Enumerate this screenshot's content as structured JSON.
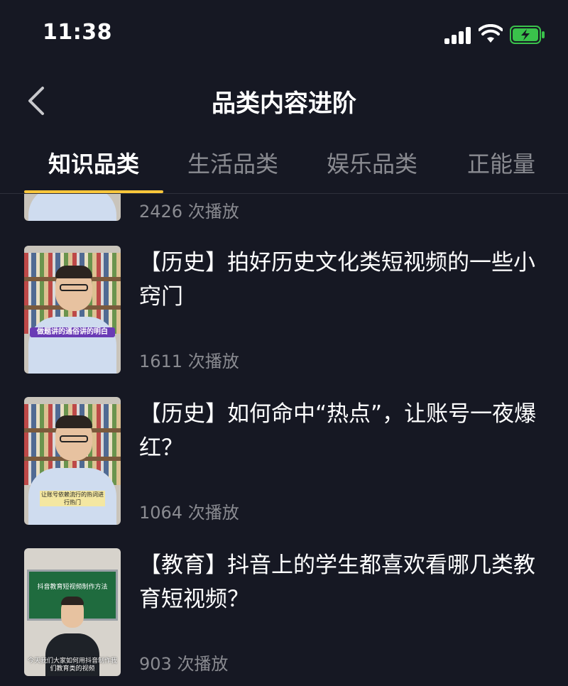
{
  "status_bar": {
    "time": "11:38"
  },
  "nav": {
    "title": "品类内容进阶"
  },
  "tabs": [
    {
      "label": "知识品类",
      "active": true
    },
    {
      "label": "生活品类",
      "active": false
    },
    {
      "label": "娱乐品类",
      "active": false
    },
    {
      "label": "正能量",
      "active": false
    }
  ],
  "videos": [
    {
      "title": "",
      "views": "2426 次播放"
    },
    {
      "title": "【历史】拍好历史文化类短视频的一些小窍门",
      "views": "1611 次播放",
      "thumb_caption": "做题讲的通俗讲的明白"
    },
    {
      "title": "【历史】如何命中“热点”，让账号一夜爆红？",
      "views": "1064 次播放",
      "thumb_caption": "让账号依赖流行的热词进行热门"
    },
    {
      "title": "【教育】抖音上的学生都喜欢看哪几类教育短视频？",
      "views": "903 次播放",
      "thumb_board": "抖音教育短视频制作方法",
      "thumb_caption": "今天我们大家如何用抖音制作我们教育类的视频"
    }
  ],
  "colors": {
    "background": "#161823",
    "accent": "#fbc73b",
    "muted": "#8a8b91",
    "battery": "#3ac24b"
  }
}
